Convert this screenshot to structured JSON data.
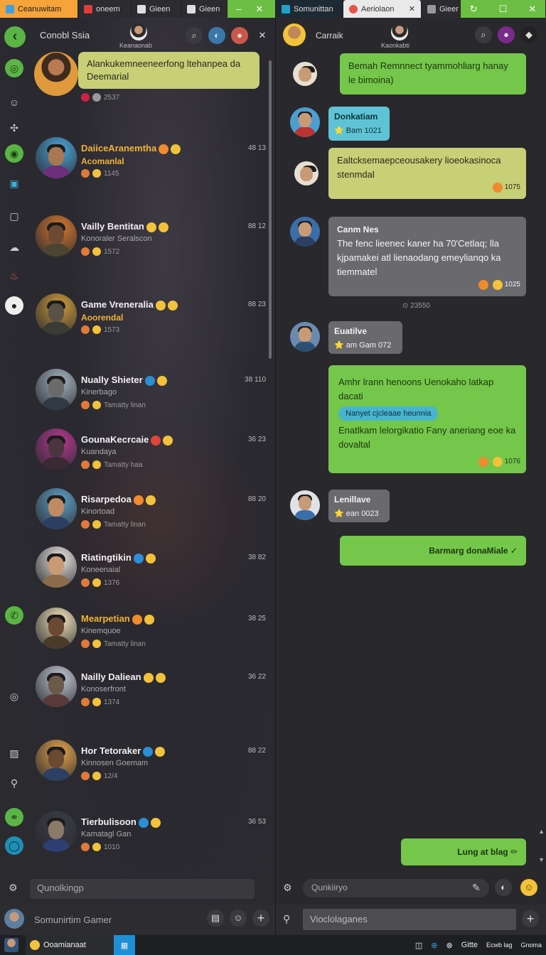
{
  "tabs": [
    {
      "label": "Ceanuwitam",
      "style": "active-left",
      "icon_color": "#3fa0e0"
    },
    {
      "label": "oneem",
      "style": "dark",
      "icon_color": "#e23a3a"
    },
    {
      "label": "Gieen",
      "style": "dark",
      "icon_color": "#e0e0e0"
    },
    {
      "label": "Gieen",
      "style": "dark",
      "icon_color": "#e0e0e0"
    },
    {
      "label": "Somunittan",
      "style": "dark",
      "icon_color": "#1ea2c9"
    },
    {
      "label": "Aeriolaon",
      "style": "light",
      "icon_color": "#e7554a"
    },
    {
      "label": "Gieer",
      "style": "dark",
      "icon_color": "#999999"
    }
  ],
  "window_controls": {
    "min": "–",
    "close": "✕",
    "restore": "☐"
  },
  "left": {
    "header_title": "Conobl Ssia",
    "header_sub": "Keanaonab",
    "top_message": {
      "text": "Alankukemneeneerfong ltehanpea da Deemarial",
      "meta": "2537"
    },
    "contacts": [
      {
        "name": "DaiiceAranemtha",
        "line2": "Acomanlal",
        "line3": "1145",
        "time": "48 13",
        "gold": true,
        "line2_gold": true,
        "badge": "b-orange",
        "bg": "#4aa3d6",
        "face": "#a97852",
        "body": "#6b2f7c"
      },
      {
        "name": "Vailly Bentitan",
        "line2": "Konoraler Seralscon",
        "line3": "1572",
        "time": "88 12",
        "gold": false,
        "line2_gold": false,
        "badge": "b-yellow",
        "bg": "#d2762e",
        "face": "#6b4a31",
        "body": "#4a4430"
      },
      {
        "name": "Game Vreneralia",
        "line2": "Aoorendal",
        "line3": "1573",
        "time": "88 23",
        "gold": false,
        "line2_gold": true,
        "badge": "b-yellow",
        "bg": "#cc9a3a",
        "face": "#5a5146",
        "body": "#3b3b36"
      },
      {
        "name": "Nually Shieter",
        "line2": "Kinerbago",
        "line3": "Tamatty linan",
        "time": "38 110",
        "gold": false,
        "line2_gold": false,
        "badge": "b-blue",
        "bg": "#a3b3c0",
        "face": "#6a6a6a",
        "body": "#2f3a44"
      },
      {
        "name": "GounaKecrcaie",
        "line2": "Kuandaya",
        "line3": "Tamatty haa",
        "time": "36 23",
        "gold": false,
        "line2_gold": false,
        "badge": "b-red",
        "bg": "#b3388f",
        "face": "#4a3540",
        "body": "#3a2a33"
      },
      {
        "name": "Risarpedoa",
        "line2": "Kinortoad",
        "line3": "Tamatty linan",
        "time": "88 20",
        "gold": false,
        "line2_gold": false,
        "badge": "b-orange",
        "bg": "#5d9fc4",
        "face": "#c08a63",
        "body": "#2d3f63"
      },
      {
        "name": "Riatingtikin",
        "line2": "Koneenaial",
        "line3": "1376",
        "time": "38 82",
        "gold": false,
        "line2_gold": false,
        "badge": "b-blue",
        "bg": "#e8e4de",
        "face": "#c99a76",
        "body": "#8b6b4a"
      },
      {
        "name": "Mearpetian",
        "line2": "Kinemquoe",
        "line3": "Tamatty linan",
        "time": "38 25",
        "gold": true,
        "line2_gold": false,
        "badge": "b-orange",
        "bg": "#f2e2b8",
        "face": "#6b4a31",
        "body": "#4a3a2a"
      },
      {
        "name": "Nailly Daliean",
        "line2": "Konoserfront",
        "line3": "1374",
        "time": "36 22",
        "gold": false,
        "line2_gold": false,
        "badge": "b-yellow",
        "bg": "#c0c8d3",
        "face": "#6b5a4a",
        "body": "#5a3a3a"
      },
      {
        "name": "Hor Tetoraker",
        "line2": "Kinnosen Goemam",
        "line3": "12/4",
        "time": "88 22",
        "gold": false,
        "line2_gold": false,
        "badge": "b-blue",
        "bg": "#e0a14a",
        "face": "#6b4a31",
        "body": "#2d3f63"
      },
      {
        "name": "Tierbulisoon",
        "line2": "Kamatagl Gan",
        "line3": "1010",
        "time": "36 53",
        "gold": false,
        "line2_gold": false,
        "badge": "b-blue",
        "bg": "#3a3d45",
        "face": "#8a7a6a",
        "body": "#2d3f73"
      }
    ],
    "input_placeholder": "Qunolkingp",
    "footer_name": "Somunirtim Gamer"
  },
  "right": {
    "header_title": "Carraik",
    "header_sub": "Kaonkabti",
    "messages": [
      {
        "kind": "green",
        "text": "Bemah Remnnect tyammohliarg hanay le bimoina)"
      },
      {
        "kind": "cyan",
        "name": "Donkatiam",
        "sub": "Bam 1021"
      },
      {
        "kind": "khaki",
        "text": "Ealtcksemaepceousakery lioeokasinoca stenmdal",
        "meta": "1075"
      },
      {
        "kind": "gray",
        "name": "Canm Nes",
        "text": "The fenc lieenec kaner ha 70'Cetlaq; lla kjpamakei atl lienaodang emeylianqo ka tiemmatel",
        "meta": "1025"
      },
      {
        "kind": "gray-small",
        "name": "Euatilve",
        "sub": "am Gam 072"
      },
      {
        "kind": "green-big",
        "text": "Amhr lrann henoons Uenokaho latkap dacati",
        "tag": "Nanyet cjcleaae heunnia",
        "text2": "Enatlkam lelorgikatio Fany aneriang eoe ka dovaltal",
        "meta": "1076"
      },
      {
        "kind": "gray-small",
        "name": "Lenillave",
        "sub": "ean 0023"
      },
      {
        "kind": "green-right",
        "text": "Barmarg donaMiale ✓"
      },
      {
        "kind": "green-bottom",
        "text": "Lung at blag ✏"
      }
    ],
    "system_text": "⊙ 23550",
    "input_placeholder": "Qunkiiryo",
    "footer_input": "Vioclolaganes"
  },
  "taskbar": {
    "start_label": "Ooamianaat",
    "tray_items": [
      "Gitte",
      "Ecwb lag",
      "Gnoma"
    ],
    "tray_icons": [
      "◫",
      "⊕",
      "⊗",
      "▭",
      "⊙"
    ]
  }
}
